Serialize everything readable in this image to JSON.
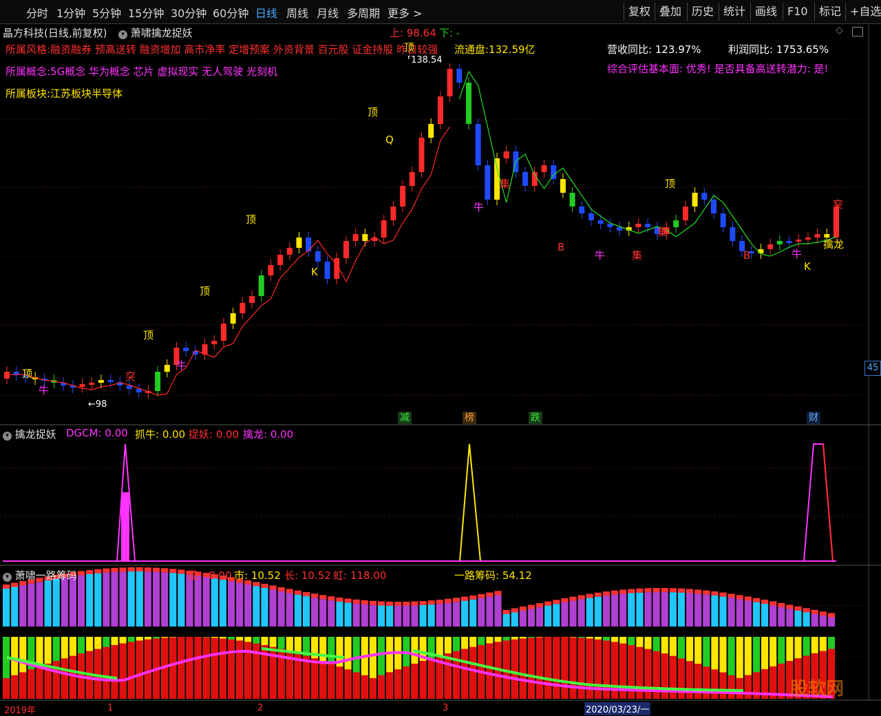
{
  "toolbar": {
    "periods": [
      "分时",
      "1分钟",
      "5分钟",
      "15分钟",
      "30分钟",
      "60分钟",
      "日线",
      "周线",
      "月线",
      "多周期",
      "更多 >"
    ],
    "active_period": "日线",
    "right_buttons": [
      "复权",
      "叠加",
      "历史",
      "统计",
      "画线",
      "F10",
      "标记",
      "+自选"
    ]
  },
  "main": {
    "stock": "晶方科技(日线,前复权)",
    "indicator": "萧啸擒龙捉妖",
    "upper_label": "上: 98.64",
    "lower_label": "下: -",
    "style_line": "所属风格:融资融券 预高送转 融资增加 高市净率 定增预案 外资背景 百元股 证金持股 昨日较强",
    "concept_line": "所属概念:5G概念 华为概念 芯片 虚拟现实 无人驾驶 光刻机",
    "sector_line": "所属板块:江苏板块半导体",
    "float_cap": "流通盘:132.59亿",
    "revenue_yoy": "营收同比: 123.97%",
    "profit_yoy": "利润同比: 1753.65%",
    "assessment": "综合评估基本面: 优秀! 是否具备高送转潜力: 是!",
    "high_price": "138.54",
    "low_price": "98",
    "price_axis_tag": "45",
    "event_tags": [
      "减",
      "榜",
      "跌",
      "财"
    ],
    "markers": {
      "top": "顶",
      "niu": "牛",
      "tu": "突",
      "ji": "集",
      "b": "B",
      "k": "K",
      "q": "Q",
      "qinlong": "擒龙"
    }
  },
  "pane2": {
    "title": "擒龙捉妖",
    "dgcm": "DGCM: 0.00",
    "zhuaniu": "抓牛: 0.00",
    "zhuoyao": "捉妖: 0.00",
    "qinlong": "擒龙: 0.00"
  },
  "pane3": {
    "title": "萧啸一路筹码",
    "gu": "股: -8.00",
    "shi": "市: 10.52",
    "zhang": "长: 10.52",
    "hong": "虹: 118.00",
    "yilu": "一路筹码: 54.12"
  },
  "time_axis": {
    "labels": [
      "2019年",
      "1",
      "2",
      "3",
      "2020/03/23/一"
    ]
  },
  "watermark": "股软网",
  "colors": {
    "up": "#ff2a2a",
    "down": "#1f4bff",
    "yellow": "#ffe600",
    "green": "#22cc22",
    "magenta": "#ff33ff",
    "cyan": "#22c6ff"
  },
  "chart_data": {
    "type": "candlestick",
    "upper": 98.64,
    "high_label": 138.54,
    "low_label": 98
  }
}
